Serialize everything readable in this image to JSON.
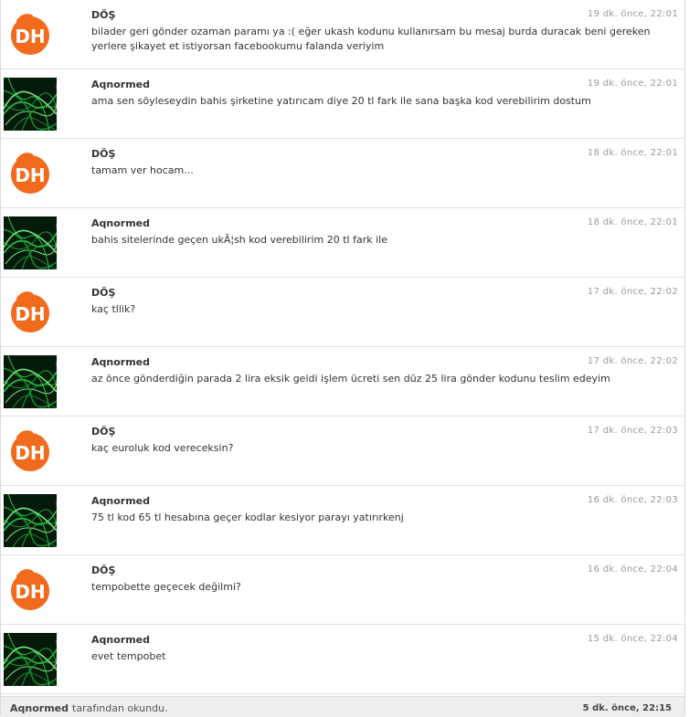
{
  "messages": [
    {
      "sender": "DÖŞ",
      "avatar": "orange-logo-avatar",
      "time": "19 dk. önce, 22:01",
      "text": "bilader geri gönder ozaman paramı ya :( eğer ukash kodunu kullanırsam bu mesaj burda duracak beni gereken yerlere şikayet et istiyorsan facebookumu falanda veriyim"
    },
    {
      "sender": "Aqnormed",
      "avatar": "green-lights-avatar",
      "time": "19 dk. önce, 22:01",
      "text": "ama sen söyleseydin bahis şirketine yatırıcam diye 20 tl fark ile sana başka kod verebilirim dostum"
    },
    {
      "sender": "DÖŞ",
      "avatar": "orange-logo-avatar",
      "time": "18 dk. önce, 22:01",
      "text": "tamam ver hocam..."
    },
    {
      "sender": "Aqnormed",
      "avatar": "green-lights-avatar",
      "time": "18 dk. önce, 22:01",
      "text": "bahis sitelerinde geçen ukÃ¦sh kod verebilirim 20 tl fark ile"
    },
    {
      "sender": "DÖŞ",
      "avatar": "orange-logo-avatar",
      "time": "17 dk. önce, 22:02",
      "text": "kaç tllik?"
    },
    {
      "sender": "Aqnormed",
      "avatar": "green-lights-avatar",
      "time": "17 dk. önce, 22:02",
      "text": "az önce gönderdiğin parada 2 lira eksik geldi işlem ücreti sen düz 25 lira gönder kodunu teslim edeyim"
    },
    {
      "sender": "DÖŞ",
      "avatar": "orange-logo-avatar",
      "time": "17 dk. önce, 22:03",
      "text": "kaç euroluk kod vereceksin?"
    },
    {
      "sender": "Aqnormed",
      "avatar": "green-lights-avatar",
      "time": "16 dk. önce, 22:03",
      "text": "75 tl kod 65 tl hesabına geçer kodlar kesiyor parayı yatırırkenj"
    },
    {
      "sender": "DÖŞ",
      "avatar": "orange-logo-avatar",
      "time": "16 dk. önce, 22:04",
      "text": "tempobette geçecek değilmi?"
    },
    {
      "sender": "Aqnormed",
      "avatar": "green-lights-avatar",
      "time": "15 dk. önce, 22:04",
      "text": "evet tempobet"
    }
  ],
  "read_receipt": {
    "reader": "Aqnormed",
    "suffix": "tarafından okundu.",
    "time": "5 dk. önce, 22:15"
  },
  "colors": {
    "orange_avatar": "#f26b1d",
    "green_avatar": "#1fae3a"
  }
}
